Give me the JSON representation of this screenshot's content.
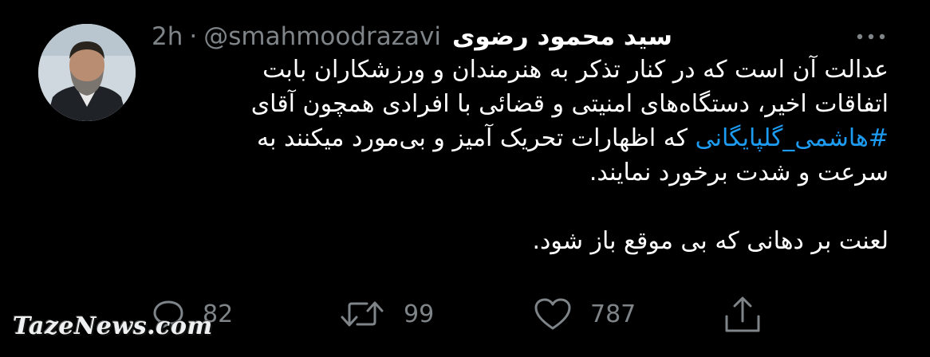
{
  "tweet": {
    "author_name": "سید محمود رضوی",
    "handle": "@smahmoodrazavi",
    "separator": "·",
    "time": "2h",
    "text_line1": "عدالت آن است که در کنار تذکر به هنرمندان و ورزشکاران بابت",
    "text_line2": "اتفاقات اخیر، دستگاه‌های امنیتی و قضائی با افرادی همچون آقای",
    "hashtag": "#هاشمی_گلپایگانی",
    "text_line3_rest": " که اظهارات تحریک آمیز و بی‌مورد میکنند به",
    "text_line4": "سرعت و شدت برخورد نمایند.",
    "text_line5": "لعنت بر دهانی که بی موقع باز شود."
  },
  "actions": {
    "reply_count": "82",
    "retweet_count": "99",
    "like_count": "787"
  },
  "watermark": "TazeNews.com",
  "icons": [
    "more-icon",
    "reply-icon",
    "retweet-icon",
    "like-icon",
    "share-icon"
  ],
  "colors": {
    "background": "#000000",
    "text": "#ffffff",
    "muted": "#7e8488",
    "link": "#1d9bf0"
  }
}
